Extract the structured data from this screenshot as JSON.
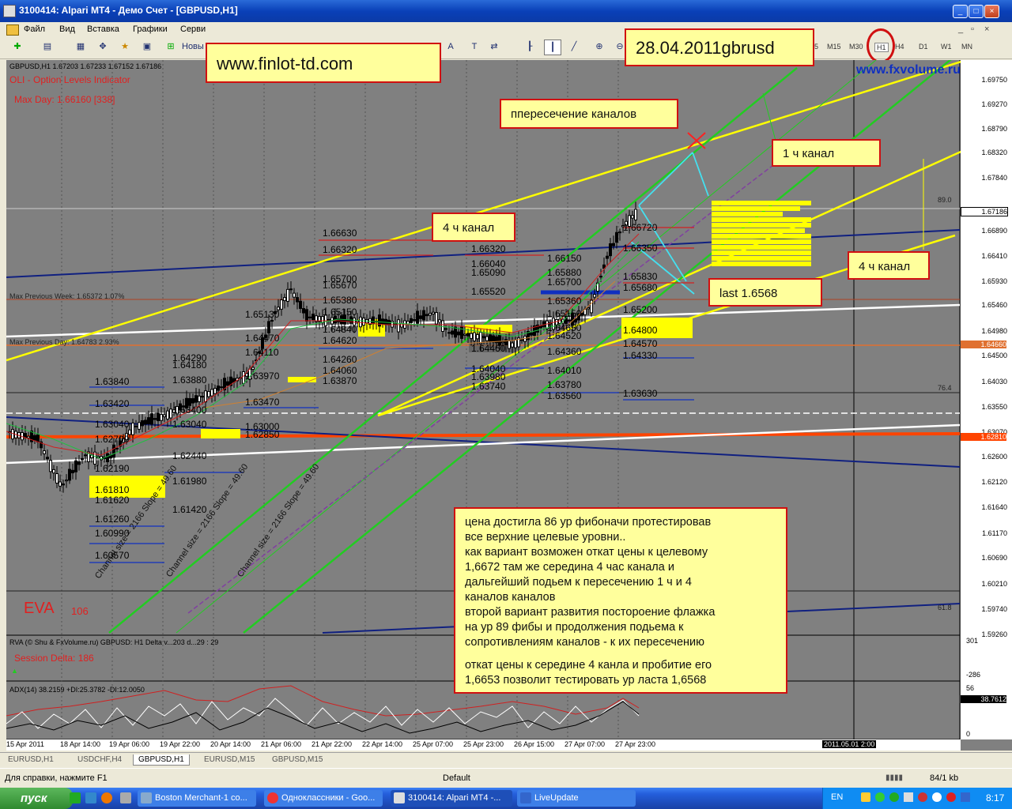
{
  "window": {
    "title": "3100414: Alpari MT4 - Демо Счет - [GBPUSD,H1]",
    "buttons": [
      "_",
      "□",
      "×"
    ]
  },
  "menu": {
    "items": [
      "Файл",
      "Вид",
      "Вставка",
      "Графики",
      "Серви"
    ]
  },
  "toolbar": {
    "new_order_label": "Новы",
    "timeframes": [
      "M15",
      "M30",
      "H1",
      "H4",
      "D1",
      "W1",
      "MN"
    ],
    "active_timeframe": "H1"
  },
  "overlays": {
    "site_note": "www.finlot-td.com",
    "date_note": "28.04.2011gbrusd",
    "fxvolume": "www.fxvolume.ru",
    "cross_note": "ппересечение каналов",
    "channel_1h": "1 ч канал",
    "channel_4h_left": "4 ч канал",
    "channel_4h_right": "4 ч канал",
    "last_note": "last 1.6568",
    "analysis_lines": [
      "цена  достигла 86 ур фибоначи протестировав",
      "все  верхние целевые  уровни..",
      " как вариант  возможен откат цены к целевому",
      "1,6672 там же середина 4 час канала  и",
      "дальгейший подьем к  пересечению 1 ч и 4",
      "каналов каналов",
      "второй вариант  развития  посторое­ние флажка",
      "на ур  89 фибы и продолжения подьема  к",
      " сопротивлениям каналов  - к их пересечению",
      "",
      "  откат цены  к середине 4 канла и пробитие его",
      "1,6653 позволит  тестировать  ур ласта 1,6568"
    ]
  },
  "chart": {
    "symbol_header": "GBPUSD,H1  1.67203 1.67233 1.67152 1.67186",
    "indicator_name": "OLI - Option Levels Indicator",
    "max_day": "Max Day: 1.66160 [338]",
    "eva": "EVA",
    "eva_value": "106",
    "channel_label": "Channel size = 2166 Slope = 49.60",
    "fib_89": "89.0",
    "fib_76": "76.4",
    "fib_61": "61.8",
    "prev_week_label": "Max Previous Week: 1.65372 1.07%",
    "prev_day_label": "Max Previous Day: 1.64783 2.93%",
    "left_levels": [
      "1.63840",
      "1.63420",
      "1.63040",
      "1.62700",
      "1.62190",
      "1.61810",
      "1.61620",
      "1.61260",
      "1.60990",
      "1.60570"
    ],
    "col2_levels": [
      "1.64290",
      "1.64180",
      "1.63880",
      "1.63400",
      "1.63040",
      "1.62440",
      "1.61980",
      "1.61420"
    ],
    "col3_levels": [
      "1.65130",
      "1.64470",
      "1.64110",
      "1.63970",
      "1.63470",
      "1.63000",
      "1.62850"
    ],
    "col4_levels": [
      "1.66630",
      "1.66320",
      "1.65700",
      "1.65670",
      "1.65380",
      "1.65150",
      "1.64840",
      "1.64620",
      "1.64260",
      "1.64060",
      "1.63870"
    ],
    "col5_levels": [
      "1.66320",
      "1.66040",
      "1.65090",
      "1.65520",
      "1.64460",
      "1.64040",
      "1.63980",
      "1.63740"
    ],
    "col6_levels": [
      "1.66150",
      "1.65880",
      "1.65700",
      "1.65360",
      "1.65150",
      "1.64650",
      "1.64520",
      "1.64360",
      "1.64010",
      "1.63780",
      "1.63560"
    ],
    "col7_levels": [
      "1.66720",
      "1.66350",
      "1.65830",
      "1.65680",
      "1.65200",
      "1.64800",
      "1.64570",
      "1.64330",
      "1.63630"
    ],
    "price_axis": [
      "1.69750",
      "1.69270",
      "1.68790",
      "1.68320",
      "1.67840",
      "1.67186",
      "1.66890",
      "1.66410",
      "1.65930",
      "1.65460",
      "1.64980",
      "1.64500",
      "1.64030",
      "1.63550",
      "1.63070",
      "1.62600",
      "1.62120",
      "1.61640",
      "1.61170",
      "1.60690",
      "1.60210",
      "1.59740",
      "1.59260"
    ],
    "current_price": "1.67186",
    "orange_price": "1.64660",
    "red_price": "1.62810",
    "time_axis": [
      "15 Apr 2011",
      "18 Apr 14:00",
      "19 Apr 06:00",
      "19 Apr 22:00",
      "20 Apr 14:00",
      "21 Apr 06:00",
      "21 Apr 22:00",
      "22 Apr 14:00",
      "25 Apr 07:00",
      "25 Apr 23:00",
      "26 Apr 15:00",
      "27 Apr 07:00",
      "27 Apr 23:00"
    ],
    "time_cursor": "2011.05.01 2:00",
    "rva_header": "RVA (© Shu & FxVolume.ru) GBPUSD: H1 Delta   v...203 d...29 : 29",
    "session_delta": "Session Delta: 186",
    "rva_scale": [
      "301",
      "-286"
    ],
    "adx_header": "ADX(14) 38.2159 +DI:25.3782 -DI:12.0050",
    "adx_scale": [
      "56",
      "38.7612",
      "0"
    ]
  },
  "chart_tabs": [
    "EURUSD,H1",
    "USDCHF,H4",
    "GBPUSD,H1",
    "EURUSD,M15",
    "GBPUSD,M15"
  ],
  "active_tab": "GBPUSD,H1",
  "status": {
    "help": "Для справки, нажмите F1",
    "profile": "Default",
    "traffic": "84/1 kb"
  },
  "taskbar": {
    "start_label": "пуск",
    "tasks": [
      "Boston Merchant-1 co...",
      "Одноклассники - Goo...",
      "3100414: Alpari MT4 -...",
      "LiveUpdate"
    ],
    "lang": "EN",
    "clock": "8:17"
  },
  "colors": {
    "chart_bg": "#808080",
    "channel_yellow": "#ffff00",
    "channel_green": "#22cc22",
    "note_bg": "#ffff9c",
    "note_border": "#d01010"
  }
}
